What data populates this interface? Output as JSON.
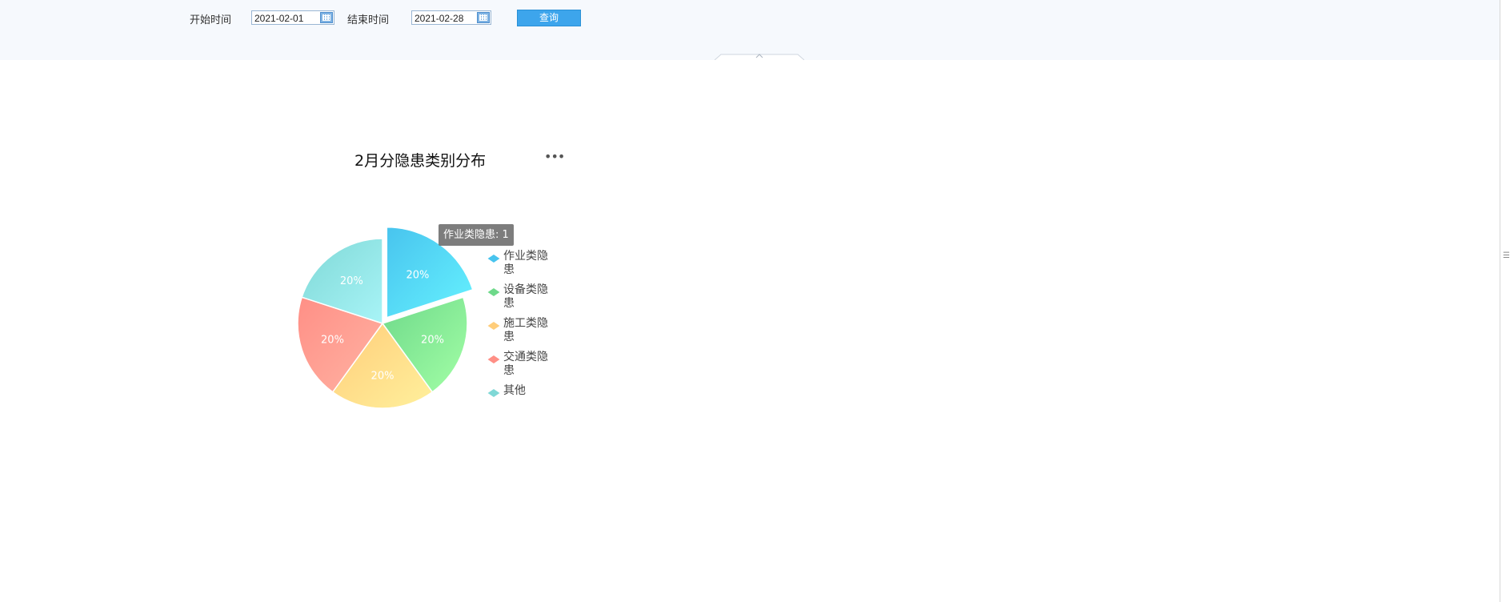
{
  "filters": {
    "start_label": "开始时间",
    "start_value": "2021-02-01",
    "end_label": "结束时间",
    "end_value": "2021-02-28",
    "query_label": "查询"
  },
  "tooltip": {
    "text": "作业类隐患: 1"
  },
  "colors": {
    "accent": "#3da5ec",
    "toolbar_bg": "#f6f9fd"
  },
  "chart_data": {
    "type": "pie",
    "title": "2月分隐患类别分布",
    "slices": [
      {
        "name": "作业类隐患",
        "value": 1,
        "percent": "20%",
        "color_a": "#66f2ff",
        "color_b": "#48c4ee",
        "highlighted": true
      },
      {
        "name": "设备类隐患",
        "value": 1,
        "percent": "20%",
        "color_a": "#a3ffa6",
        "color_b": "#6ed98a"
      },
      {
        "name": "施工类隐患",
        "value": 1,
        "percent": "20%",
        "color_a": "#fff09c",
        "color_b": "#ffcd7a"
      },
      {
        "name": "交通类隐患",
        "value": 1,
        "percent": "20%",
        "color_a": "#ffb3a3",
        "color_b": "#ff8f86"
      },
      {
        "name": "其他",
        "value": 1,
        "percent": "20%",
        "color_a": "#a8f4f7",
        "color_b": "#7fd8d6"
      }
    ],
    "legend_position": "right"
  }
}
